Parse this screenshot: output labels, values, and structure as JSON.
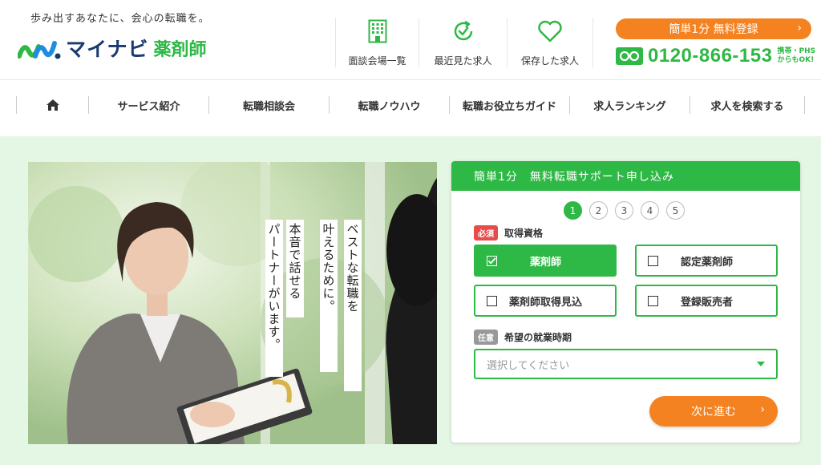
{
  "header": {
    "tagline": "歩み出すあなたに、会心の転職を。",
    "logo_text": "マイナビ",
    "logo_sub": "薬剤師",
    "nav": [
      {
        "label": "面談会場一覧",
        "icon": "building-icon"
      },
      {
        "label": "最近見た求人",
        "icon": "history-icon"
      },
      {
        "label": "保存した求人",
        "icon": "heart-icon"
      }
    ],
    "register_label": "簡単1分 無料登録",
    "phone_number": "0120-866-153",
    "phone_note_1": "携帯・PHS",
    "phone_note_2": "からもOK!"
  },
  "global_nav": {
    "home_icon": "home-icon",
    "items": [
      "サービス紹介",
      "転職相談会",
      "転職ノウハウ",
      "転職お役立ちガイド",
      "求人ランキング",
      "求人を検索する"
    ]
  },
  "hero": {
    "copy_1": "ベストな転職を",
    "copy_2": "叶えるために。",
    "copy_3": "本音で話せる",
    "copy_4": "パートナーがいます。"
  },
  "form": {
    "title": "簡単1分　無料転職サポート申し込み",
    "steps": [
      "1",
      "2",
      "3",
      "4",
      "5"
    ],
    "active_step": 1,
    "q1_tag": "必須",
    "q1_label": "取得資格",
    "options": [
      {
        "label": "薬剤師",
        "checked": true
      },
      {
        "label": "認定薬剤師",
        "checked": false
      },
      {
        "label": "薬剤師取得見込",
        "checked": false
      },
      {
        "label": "登録販売者",
        "checked": false
      }
    ],
    "q2_tag": "任意",
    "q2_label": "希望の就業時期",
    "select_placeholder": "選択してください",
    "next_label": "次に進む"
  },
  "colors": {
    "green": "#2eb845",
    "orange": "#f58220",
    "navy": "#1a3a6e",
    "bg_green": "#e4f6e4"
  }
}
